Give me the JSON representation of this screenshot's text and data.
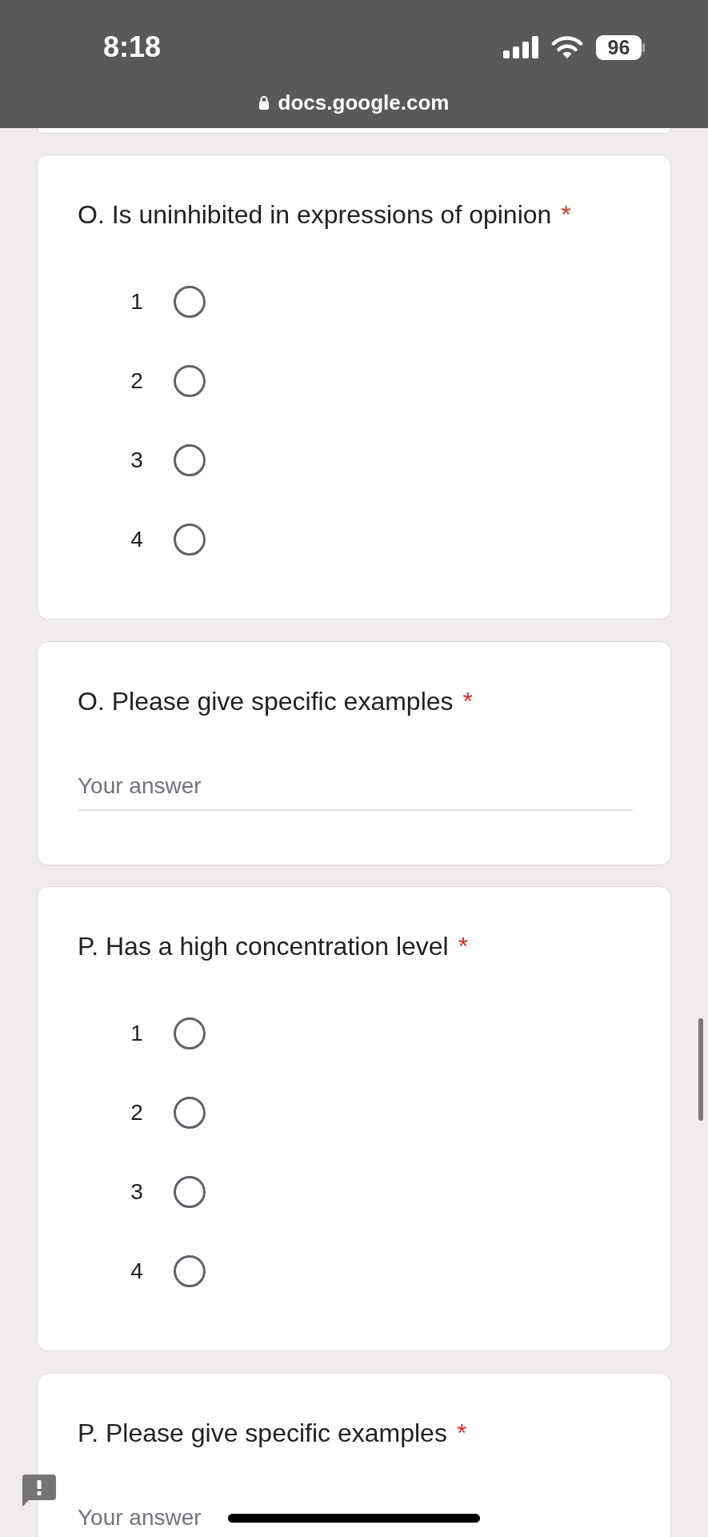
{
  "status_bar": {
    "time": "8:18",
    "battery": "96"
  },
  "address_bar": {
    "url": "docs.google.com"
  },
  "questions": [
    {
      "kind": "scale",
      "title": "O. Is uninhibited in expressions of opinion",
      "required_mark": "*",
      "options": [
        {
          "label": "1",
          "selected": false
        },
        {
          "label": "2",
          "selected": false
        },
        {
          "label": "3",
          "selected": false
        },
        {
          "label": "4",
          "selected": false
        }
      ]
    },
    {
      "kind": "text",
      "title": "O. Please give specific examples",
      "required_mark": "*",
      "placeholder": "Your answer"
    },
    {
      "kind": "scale",
      "title": "P. Has a high concentration level",
      "required_mark": "*",
      "options": [
        {
          "label": "1",
          "selected": false
        },
        {
          "label": "2",
          "selected": false
        },
        {
          "label": "3",
          "selected": false
        },
        {
          "label": "4",
          "selected": false
        }
      ]
    },
    {
      "kind": "text",
      "title": "P. Please give specific examples",
      "required_mark": "*",
      "placeholder": "Your answer"
    }
  ]
}
